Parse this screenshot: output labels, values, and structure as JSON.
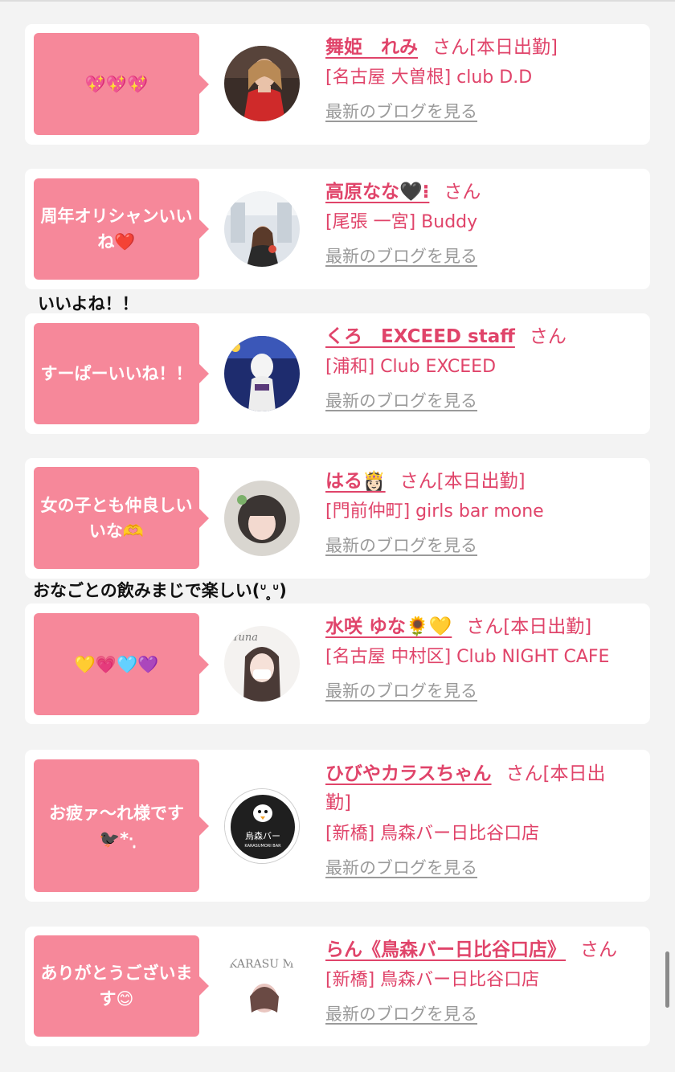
{
  "items": [
    {
      "bubble": "💖💖💖",
      "name": "舞姫　れみ",
      "suffix": "さん[本日出勤]",
      "shop": "[名古屋 大曽根] club D.D",
      "blog": "最新のブログを見る"
    },
    {
      "bubble": "周年オリシャンいいね❤️",
      "name": "高原なな🖤⁝",
      "suffix": "さん",
      "shop": "[尾張 一宮] Buddy",
      "blog": "最新のブログを見る",
      "comment_after": "いいよね！！"
    },
    {
      "bubble": "すーぱーいいね！！",
      "name": "くろ　EXCEED staff",
      "suffix": "さん",
      "shop": "[浦和] Club EXCEED",
      "blog": "最新のブログを見る"
    },
    {
      "bubble": "女の子とも仲良しいいな🫶",
      "name": "はる👸🏻",
      "suffix": "さん[本日出勤]",
      "shop": "[門前仲町] girls bar mone",
      "blog": "最新のブログを見る",
      "comment_after": "おなごとの飲みまじで楽しい(ᐡ ̥̥ᐡ)"
    },
    {
      "bubble": "💛💗🩵💜",
      "name": "水咲 ゆな🌻💛",
      "suffix": "さん[本日出勤]",
      "shop": "[名古屋 中村区] Club NIGHT CAFE",
      "blog": "最新のブログを見る"
    },
    {
      "bubble": "お疲ァ〜れ様です🐦‍⬛*·̩͙",
      "name": "ひびやカラスちゃん",
      "suffix": "さん[本日出勤]",
      "shop": "[新橋] 鳥森バー日比谷口店",
      "blog": "最新のブログを見る"
    },
    {
      "bubble": "ありがとうございます😊",
      "name": "らん《鳥森バー日比谷口店》",
      "suffix": "さん",
      "shop": "[新橋] 鳥森バー日比谷口店",
      "blog": "最新のブログを見る"
    }
  ],
  "avatars": {
    "remi": "woman-red-dress-photo",
    "nana": "woman-indoor-photo",
    "kuro": "white-costume-photo",
    "haru": "girl-portrait-photo",
    "yuna": "masked-girl-photo",
    "karasu": "crow-bar-logo",
    "ran": "karasumori-bar-logo-girl"
  },
  "avatar_labels": {
    "yuna": "Yuna",
    "karasu_logo": "烏森バー",
    "karasu_sub": "KARASUMORI BAR",
    "ran_logo": "KARASU MORI BAR"
  },
  "colors": {
    "accent": "#e0446a",
    "bubble": "#f6889a",
    "link_gray": "#9a9a9a",
    "background": "#f3f3f3"
  }
}
